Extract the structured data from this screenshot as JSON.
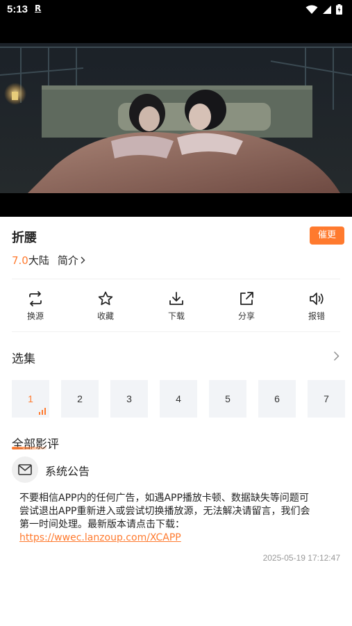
{
  "status_bar": {
    "time": "5:13",
    "notification_icon": "R"
  },
  "video": {
    "scene": "video-frame"
  },
  "header": {
    "title": "折腰",
    "urge_button": "催更",
    "score": "7.0",
    "region": "大陆",
    "intro_label": "简介"
  },
  "actions": [
    {
      "label": "换源",
      "icon": "switch-source-icon"
    },
    {
      "label": "收藏",
      "icon": "star-icon"
    },
    {
      "label": "下载",
      "icon": "download-icon"
    },
    {
      "label": "分享",
      "icon": "share-icon"
    },
    {
      "label": "报错",
      "icon": "speaker-icon"
    }
  ],
  "episodes": {
    "title": "选集",
    "items": [
      "1",
      "2",
      "3",
      "4",
      "5",
      "6",
      "7"
    ],
    "active": "1"
  },
  "reviews": {
    "title": "全部影评",
    "notice": {
      "author": "系统公告",
      "body": "不要相信APP内的任何广告，如遇APP播放卡顿、数据缺失等问题可尝试退出APP重新进入或尝试切换播放源，无法解决请留言，我们会第一时间处理。最新版本请点击下载：",
      "link": "https://wwec.lanzoup.com/XCAPP",
      "time": "2025-05-19 17:12:47"
    }
  },
  "colors": {
    "accent": "#ff7a2e",
    "episode_bg": "#f2f4f7"
  }
}
